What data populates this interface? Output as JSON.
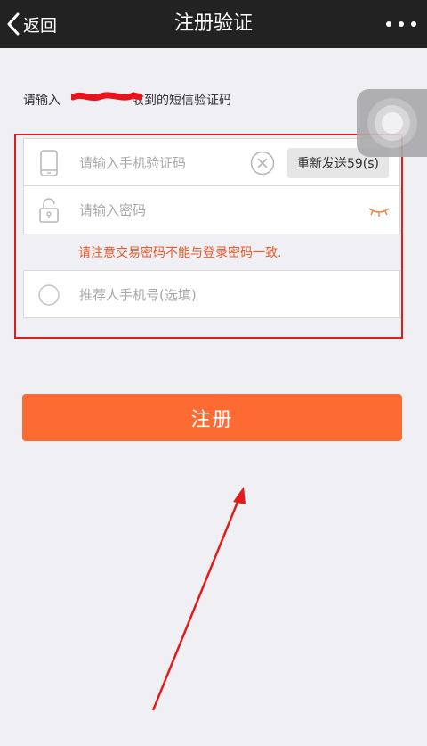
{
  "nav": {
    "back_label": "返回",
    "title": "注册验证"
  },
  "instruction": {
    "prefix": "请输入",
    "suffix": "收到的短信验证码"
  },
  "form": {
    "sms_code": {
      "placeholder": "请输入手机验证码",
      "value": ""
    },
    "resend_label": "重新发送59(s)",
    "password": {
      "placeholder": "请输入密码",
      "value": ""
    },
    "warning": "请注意交易密码不能与登录密码一致.",
    "referrer": {
      "placeholder": "推荐人手机号(选填)",
      "value": ""
    }
  },
  "register_label": "注册",
  "icons": {
    "back": "chevron-left-icon",
    "more": "more-dots-icon",
    "phone": "phone-icon",
    "clear": "clear-icon",
    "lock": "unlock-icon",
    "eye": "eye-closed-icon",
    "referrer": "circle-icon"
  },
  "colors": {
    "navbar": "#222222",
    "primary_button": "#fd6b33",
    "warning_text": "#ee5a2a",
    "highlight": "#e21b1b",
    "background": "#efeff4"
  }
}
